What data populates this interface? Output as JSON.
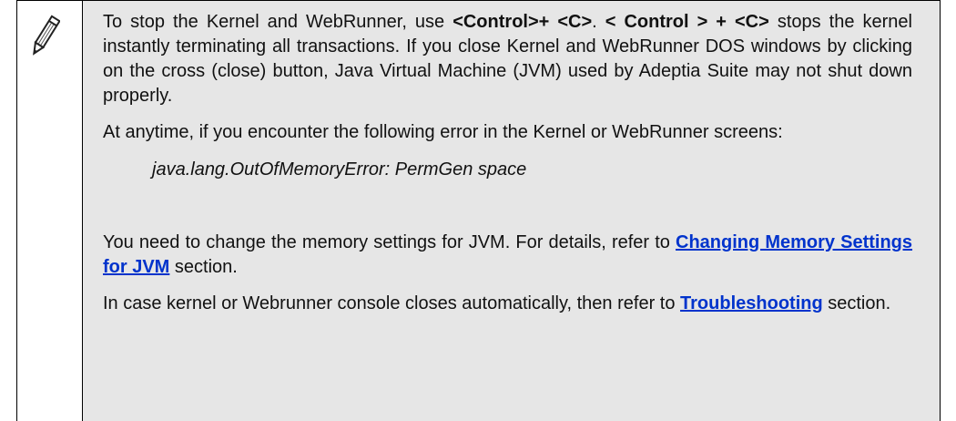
{
  "note": {
    "icon": "pencil-icon",
    "p1": {
      "t1": "To stop the Kernel and WebRunner, use ",
      "b1": "<Control>+ <C>",
      "t2": ". ",
      "b2": "< Control > + <C>",
      "t3": " stops the kernel instantly terminating all transactions. If you close Kernel and WebRunner DOS windows by clicking on the cross (close) button, Java Virtual Machine (JVM) used by Adeptia Suite may not shut down properly."
    },
    "p2": "At anytime, if you encounter the following error in the Kernel or WebRunner screens:",
    "error_text": "java.lang.OutOfMemoryError: PermGen space",
    "p3": {
      "t1": "You need to change the memory settings for JVM. For details, refer to ",
      "link": "Changing Memory Settings for JVM",
      "t2": " section."
    },
    "p4": {
      "t1": "In case kernel or Webrunner console closes automatically, then refer to ",
      "link": "Troubleshooting",
      "t2": " section."
    }
  },
  "colors": {
    "cell_bg": "#e6e6e6",
    "link": "#0033cc",
    "border": "#000000"
  }
}
